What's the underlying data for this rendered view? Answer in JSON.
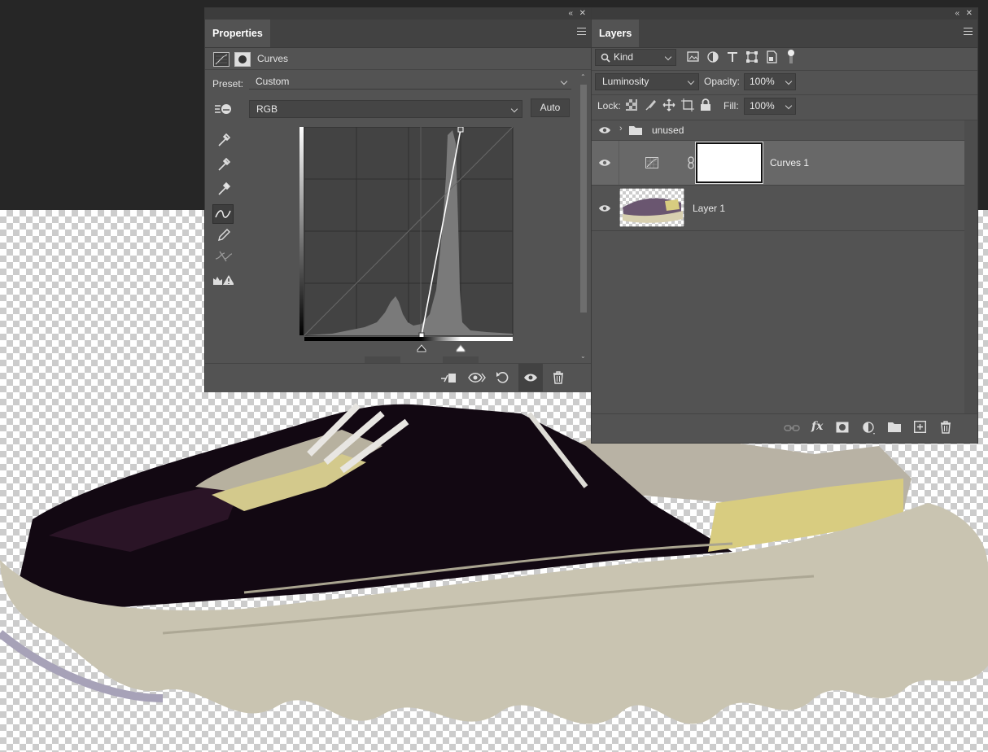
{
  "properties": {
    "tab": "Properties",
    "adjustment_title": "Curves",
    "preset_label": "Preset:",
    "preset_value": "Custom",
    "channel_value": "RGB",
    "auto_label": "Auto"
  },
  "layers": {
    "tab": "Layers",
    "filter_value": "Kind",
    "blend_mode": "Luminosity",
    "opacity_label": "Opacity:",
    "opacity_value": "100%",
    "lock_label": "Lock:",
    "fill_label": "Fill:",
    "fill_value": "100%",
    "items": [
      {
        "name": "unused"
      },
      {
        "name": "Curves 1"
      },
      {
        "name": "Layer 1"
      }
    ]
  },
  "icons": [
    "search-icon",
    "eye-icon",
    "folder-icon",
    "link-icon",
    "fx-icon",
    "mask-icon",
    "adjustment-icon",
    "new-layer-icon",
    "trash-icon",
    "eyedropper-icon",
    "pencil-icon",
    "curve-point-icon",
    "reset-icon",
    "visibility-icon",
    "clip-icon"
  ],
  "colors": {
    "panel": "#535353",
    "panel_dark": "#424242",
    "canvas": "#262626"
  }
}
